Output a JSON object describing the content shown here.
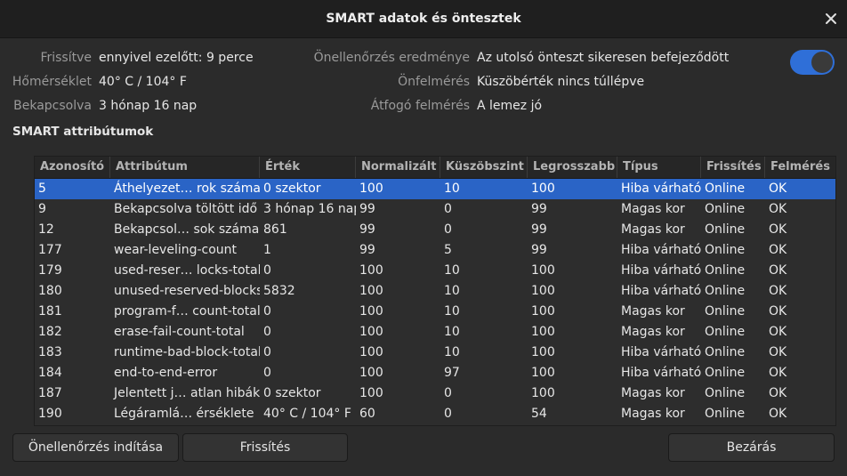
{
  "window": {
    "title": "SMART adatok és öntesztek",
    "close_icon": "close-icon"
  },
  "info_left": [
    {
      "label": "Frissítve",
      "value": "ennyivel ezelőtt: 9 perce"
    },
    {
      "label": "Hőmérséklet",
      "value": "40° C / 104° F"
    },
    {
      "label": "Bekapcsolva",
      "value": "3 hónap 16 nap"
    }
  ],
  "info_right": [
    {
      "label": "Önellenőrzés eredménye",
      "value": "Az utolsó önteszt sikeresen befejeződött"
    },
    {
      "label": "Önfelmérés",
      "value": "Küszöbérték nincs túllépve"
    },
    {
      "label": "Átfogó felmérés",
      "value": "A lemez jó"
    }
  ],
  "smart_toggle": {
    "on": true,
    "accent": "#2f6fd8"
  },
  "section_title": "SMART attribútumok",
  "table": {
    "headers": [
      "Azonosító",
      "Attribútum",
      "Érték",
      "Normalizált",
      "Küszöbszint",
      "Legrosszabb",
      "Típus",
      "Frissítés",
      "Felmérés"
    ],
    "selected_row": 0,
    "rows": [
      [
        "5",
        "Áthelyezet… rok száma",
        "0 szektor",
        "100",
        "10",
        "100",
        "Hiba várható",
        "Online",
        "OK"
      ],
      [
        "9",
        "Bekapcsolva töltött idő",
        "3 hónap 16 nap",
        "99",
        "0",
        "99",
        "Magas kor",
        "Online",
        "OK"
      ],
      [
        "12",
        "Bekapcsol… sok száma",
        "861",
        "99",
        "0",
        "99",
        "Magas kor",
        "Online",
        "OK"
      ],
      [
        "177",
        "wear-leveling-count",
        "1",
        "99",
        "5",
        "99",
        "Hiba várható",
        "Online",
        "OK"
      ],
      [
        "179",
        "used-reser… locks-total",
        "0",
        "100",
        "10",
        "100",
        "Hiba várható",
        "Online",
        "OK"
      ],
      [
        "180",
        "unused-reserved-blocks",
        "5832",
        "100",
        "10",
        "100",
        "Hiba várható",
        "Online",
        "OK"
      ],
      [
        "181",
        "program-f… count-total",
        "0",
        "100",
        "10",
        "100",
        "Magas kor",
        "Online",
        "OK"
      ],
      [
        "182",
        "erase-fail-count-total",
        "0",
        "100",
        "10",
        "100",
        "Magas kor",
        "Online",
        "OK"
      ],
      [
        "183",
        "runtime-bad-block-total",
        "0",
        "100",
        "10",
        "100",
        "Hiba várható",
        "Online",
        "OK"
      ],
      [
        "184",
        "end-to-end-error",
        "0",
        "100",
        "97",
        "100",
        "Hiba várható",
        "Online",
        "OK"
      ],
      [
        "187",
        "Jelentett j… atlan hibák",
        "0 szektor",
        "100",
        "0",
        "100",
        "Magas kor",
        "Online",
        "OK"
      ],
      [
        "190",
        "Légáramlá… érséklete",
        "40° C / 104° F",
        "60",
        "0",
        "54",
        "Magas kor",
        "Online",
        "OK"
      ]
    ]
  },
  "buttons": {
    "selftest": "Önellenőrzés indítása",
    "refresh": "Frissítés",
    "close": "Bezárás"
  }
}
